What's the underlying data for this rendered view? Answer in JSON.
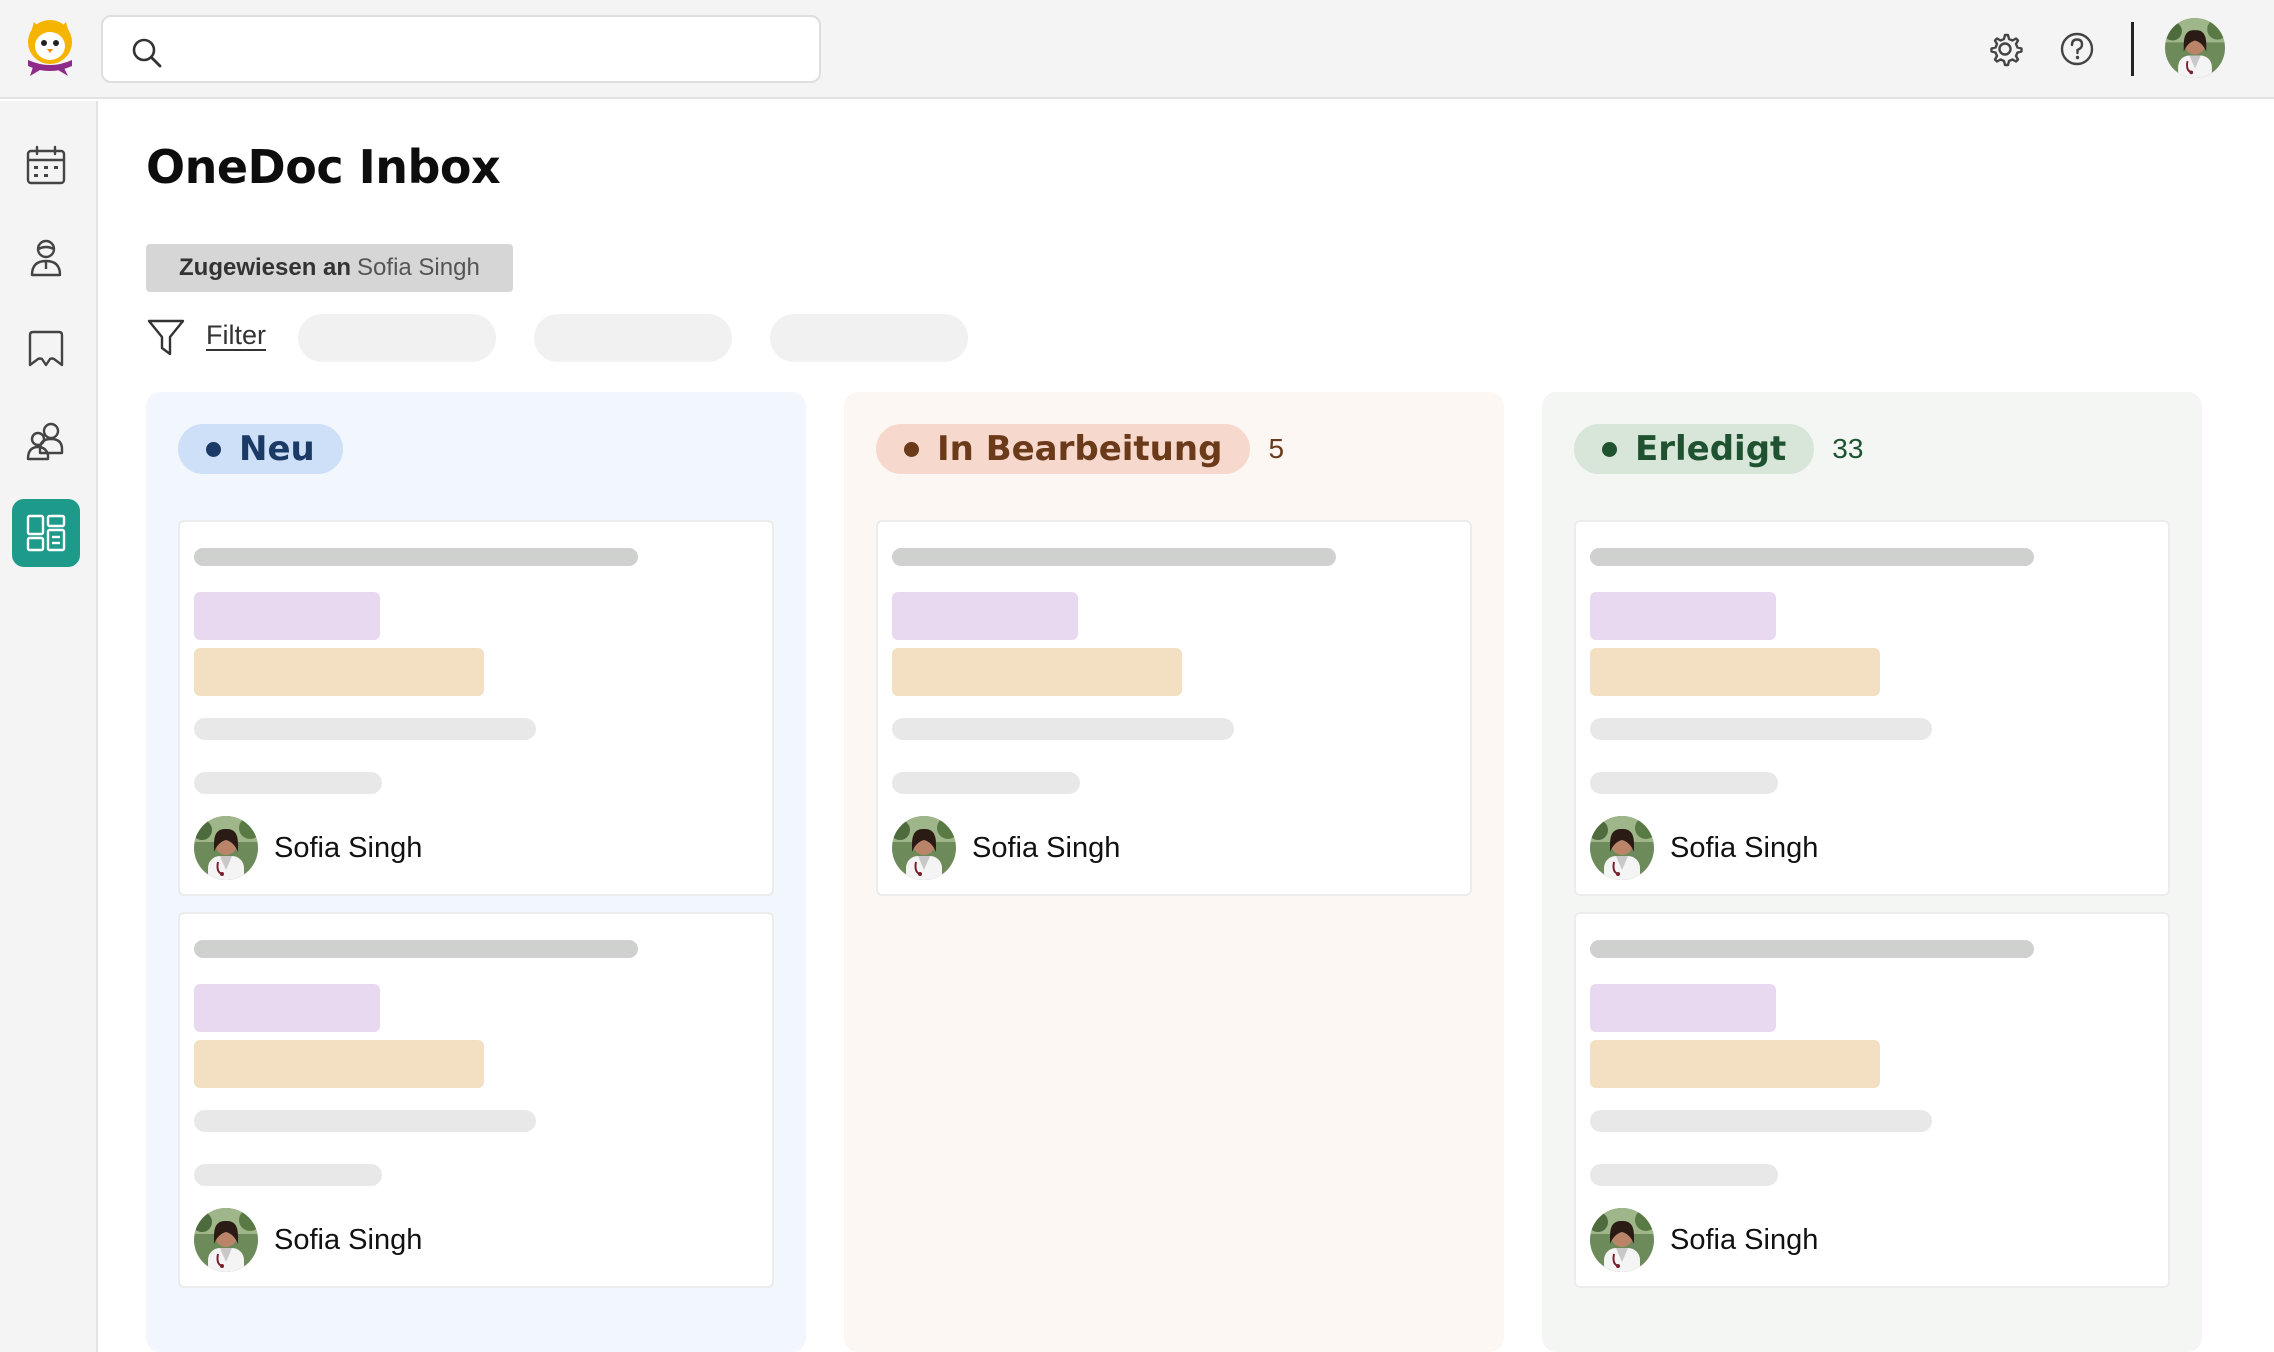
{
  "page": {
    "title": "OneDoc Inbox"
  },
  "header": {
    "search_placeholder": "",
    "icons": [
      "search-icon",
      "gear-icon",
      "help-icon",
      "avatar"
    ]
  },
  "sidebar": {
    "items": [
      {
        "icon": "calendar-icon",
        "active": false
      },
      {
        "icon": "patient-icon",
        "active": false
      },
      {
        "icon": "messages-icon",
        "active": false
      },
      {
        "icon": "team-icon",
        "active": false
      },
      {
        "icon": "board-icon",
        "active": true
      }
    ],
    "active_color": "#1d9a8a"
  },
  "assigned_chip": {
    "prefix": "Zugewiesen an",
    "value": "Sofia Singh"
  },
  "filter": {
    "label": "Filter"
  },
  "columns": [
    {
      "label": "Neu",
      "count": "",
      "color": "#1c3a66",
      "bg": "#cde0f8",
      "cards": [
        {
          "assignee": "Sofia Singh"
        },
        {
          "assignee": "Sofia Singh"
        }
      ]
    },
    {
      "label": "In Bearbeitung",
      "count": "5",
      "color": "#6b3a1a",
      "bg": "#f6d9cc",
      "cards": [
        {
          "assignee": "Sofia Singh"
        }
      ]
    },
    {
      "label": "Erledigt",
      "count": "33",
      "color": "#1f5230",
      "bg": "#d7e6d9",
      "cards": [
        {
          "assignee": "Sofia Singh"
        },
        {
          "assignee": "Sofia Singh"
        }
      ]
    }
  ]
}
